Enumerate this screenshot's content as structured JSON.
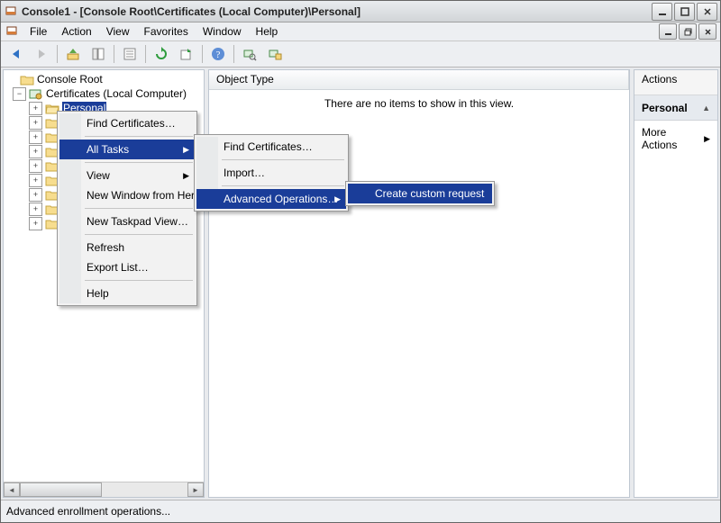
{
  "window": {
    "title": "Console1 - [Console Root\\Certificates (Local Computer)\\Personal]"
  },
  "menus": {
    "file": "File",
    "action": "Action",
    "view": "View",
    "favorites": "Favorites",
    "window": "Window",
    "help": "Help"
  },
  "tree": {
    "root": "Console Root",
    "certs": "Certificates (Local Computer)",
    "selected": "Personal"
  },
  "list": {
    "column1": "Object Type",
    "empty": "There are no items to show in this view."
  },
  "actions": {
    "title": "Actions",
    "section": "Personal",
    "more": "More Actions"
  },
  "ctx": {
    "find": "Find Certificates…",
    "alltasks": "All Tasks",
    "view": "View",
    "newwin": "New Window from Here",
    "newtaskpad": "New Taskpad View…",
    "refresh": "Refresh",
    "export": "Export List…",
    "help": "Help"
  },
  "ctx2": {
    "find": "Find Certificates…",
    "import": "Import…",
    "advanced": "Advanced Operations…"
  },
  "ctx3": {
    "create": "Create custom request"
  },
  "status": "Advanced enrollment operations..."
}
